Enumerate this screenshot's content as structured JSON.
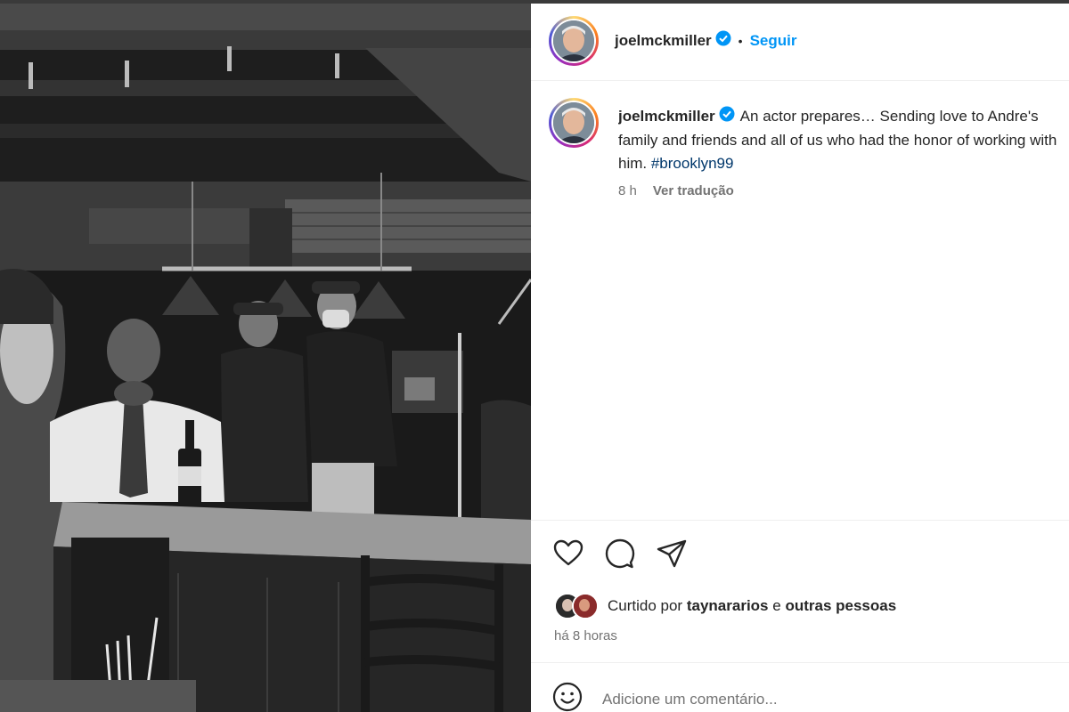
{
  "post": {
    "username": "joelmckmiller",
    "follow_label": "Seguir",
    "separator": "•",
    "caption_text": "An actor prepares… Sending love to Andre's family and friends and all of us who had the honor of working with him. ",
    "caption_hashtag": "#brooklyn99",
    "caption_age": "8 h",
    "translate_label": "Ver tradução",
    "liked_by_prefix": "Curtido por",
    "liked_by_user": "taynararios",
    "liked_by_join": "e",
    "liked_by_others": "outras pessoas",
    "timestamp": "há 8 horas",
    "comment_placeholder": "Adicione um comentário..."
  },
  "icons": {
    "like": "heart-icon",
    "comment": "comment-bubble-icon",
    "share": "paper-plane-icon",
    "emoji": "smiley-icon",
    "verified": "verified-badge-icon"
  },
  "colors": {
    "accent": "#0095f6",
    "hashtag": "#00376b",
    "verified": "#0095f6",
    "muted": "#737373"
  }
}
